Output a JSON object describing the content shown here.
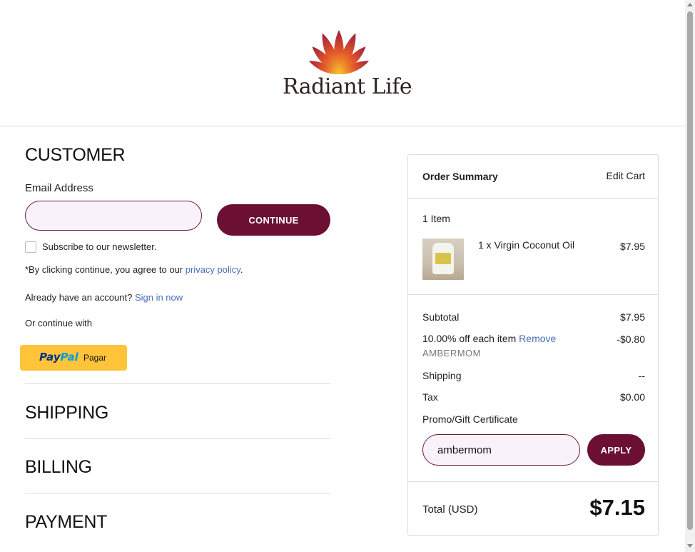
{
  "brand": {
    "logo_text": "Radiant Life",
    "logo_mark": "."
  },
  "customer": {
    "title": "CUSTOMER",
    "email_label": "Email Address",
    "email_value": "",
    "continue_label": "CONTINUE",
    "newsletter_label": "Subscribe to our newsletter.",
    "newsletter_checked": false,
    "terms_prefix": "*By clicking continue, you agree to our ",
    "terms_link": "privacy policy",
    "terms_suffix": ".",
    "account_prefix": "Already have an account? ",
    "signin_link": "Sign in now",
    "or_continue": "Or continue with",
    "paypal": {
      "pay": "Pay",
      "pal": "Pal",
      "pagar": "Pagar"
    }
  },
  "sections": {
    "shipping": "SHIPPING",
    "billing": "BILLING",
    "payment": "PAYMENT"
  },
  "summary": {
    "title": "Order Summary",
    "edit_cart": "Edit Cart",
    "item_count": "1 Item",
    "items": [
      {
        "name": "1 x Virgin Coconut Oil",
        "price": "$7.95"
      }
    ],
    "subtotal_label": "Subtotal",
    "subtotal_value": "$7.95",
    "discount_label": "10.00% off each item",
    "discount_remove": "Remove",
    "discount_code": "AMBERMOM",
    "discount_value": "-$0.80",
    "shipping_label": "Shipping",
    "shipping_value": "--",
    "tax_label": "Tax",
    "tax_value": "$0.00",
    "promo_label": "Promo/Gift Certificate",
    "promo_value": "ambermom",
    "apply_label": "APPLY",
    "total_label": "Total (USD)",
    "total_value": "$7.15"
  },
  "colors": {
    "brand": "#6b0f33",
    "link": "#4a6fb8",
    "paypal": "#ffc439",
    "input_bg": "#f9f2fa"
  }
}
